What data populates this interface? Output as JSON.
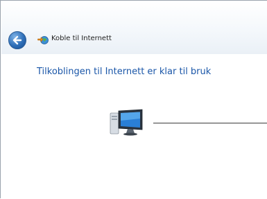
{
  "window": {
    "title": "Koble til Internett"
  },
  "navigation": {
    "back_icon": "back-arrow-icon"
  },
  "content": {
    "heading": "Tilkoblingen til Internett er klar til bruk",
    "computer_icon": "computer-icon",
    "connection_icon": "network-connection-line"
  },
  "colors": {
    "heading": "#1a56a8",
    "back_button": "#2f6fb8"
  }
}
